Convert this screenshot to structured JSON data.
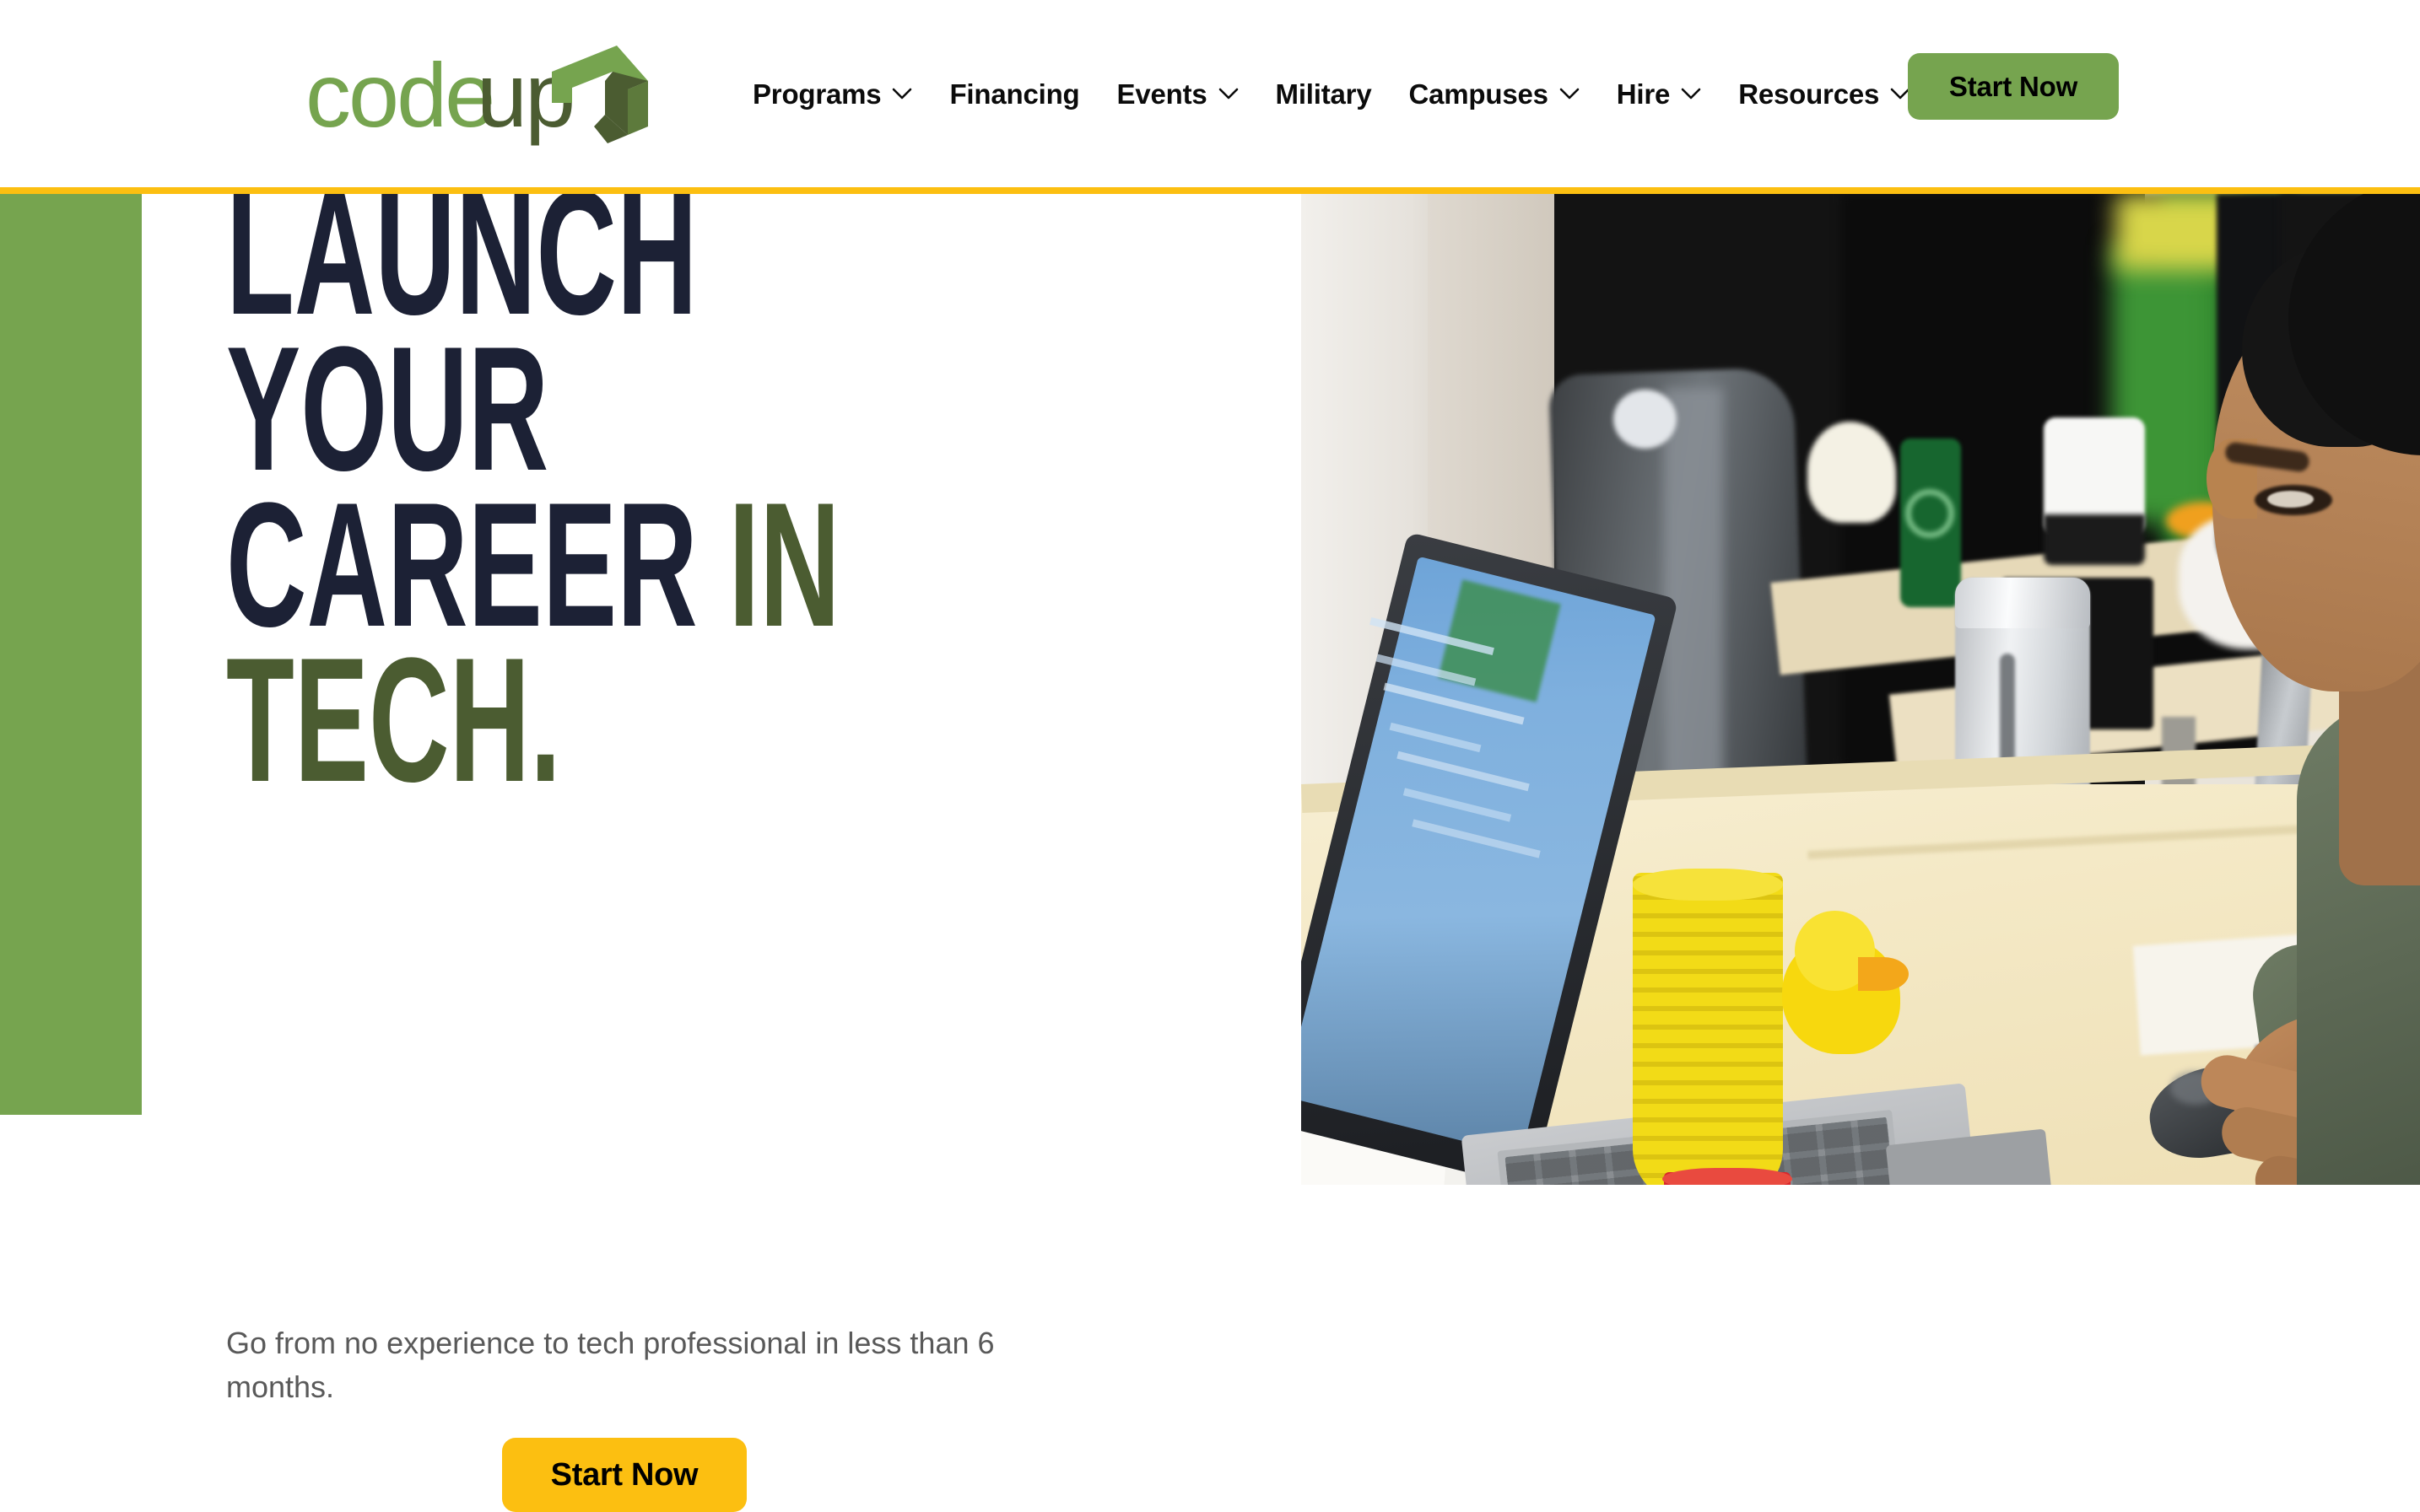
{
  "brand": {
    "name": "codeup",
    "name_part_light": "code",
    "name_part_dark": "up",
    "logo_mark": "arrow-up-chevron-mark",
    "color_light_green": "#76a44f",
    "color_dark_green": "#4b5c31"
  },
  "header": {
    "nav": [
      {
        "label": "Programs",
        "has_dropdown": true,
        "icon": "chevron-down-icon"
      },
      {
        "label": "Financing",
        "has_dropdown": false,
        "icon": ""
      },
      {
        "label": "Events",
        "has_dropdown": true,
        "icon": "chevron-down-icon"
      },
      {
        "label": "Military",
        "has_dropdown": false,
        "icon": ""
      },
      {
        "label": "Campuses",
        "has_dropdown": true,
        "icon": "chevron-down-icon"
      },
      {
        "label": "Hire",
        "has_dropdown": true,
        "icon": "chevron-down-icon"
      },
      {
        "label": "Resources",
        "has_dropdown": true,
        "icon": "chevron-down-icon"
      }
    ],
    "cta_label": "Start Now",
    "cta_color": "#76a44f"
  },
  "accent_rule_color": "#fcbf11",
  "side_block_color": "#76a44f",
  "hero": {
    "heading_lines": [
      {
        "text": "LAUNCH",
        "color": "navy"
      },
      {
        "text": "YOUR",
        "color": "navy"
      },
      {
        "text": "CAREER ",
        "color": "navy",
        "suffix": "IN",
        "suffix_color": "green"
      },
      {
        "text": "TECH.",
        "color": "green"
      }
    ],
    "line1": "LAUNCH",
    "line2": "YOUR",
    "line3a": "CAREER ",
    "line3b": "IN",
    "line4": "TECH.",
    "subtext": "Go from no experience to tech professional in less than 6 months.",
    "cta_label": "Start Now",
    "cta_color": "#fcbf11",
    "heading_navy": "#1c2135",
    "heading_green": "#4b5c31"
  },
  "photo": {
    "alt": "Student working on a laptop at a classroom desk with yellow cups, a rubber duck and a tumbler",
    "name": "hero-photo"
  }
}
